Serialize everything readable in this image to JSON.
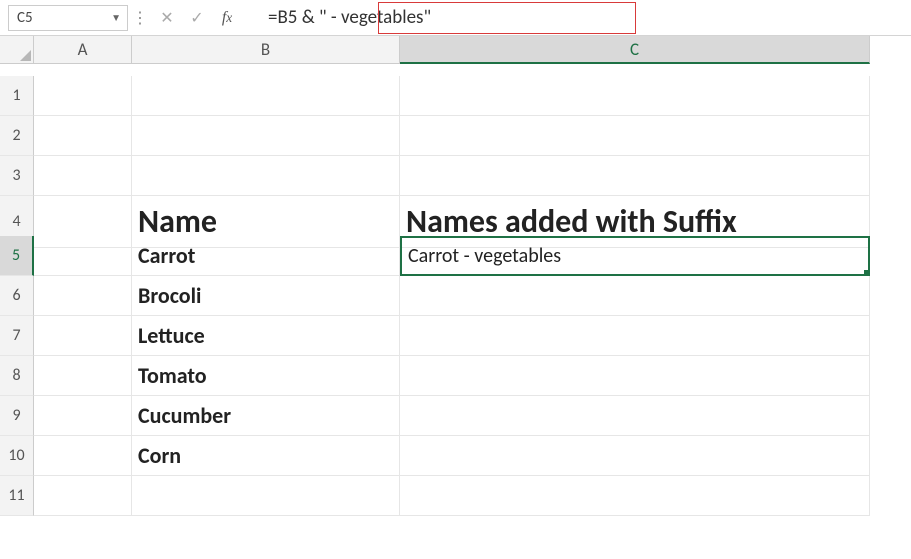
{
  "namebox": {
    "value": "C5"
  },
  "formula": {
    "text": "=B5 & \" - vegetables\""
  },
  "columns": {
    "A": "A",
    "B": "B",
    "C": "C"
  },
  "rows": [
    "1",
    "2",
    "3",
    "4",
    "5",
    "6",
    "7",
    "8",
    "9",
    "10",
    "11"
  ],
  "headers": {
    "B4": "Name",
    "C4": "Names added with Suffix"
  },
  "names": {
    "B5": "Carrot",
    "B6": "Brocoli",
    "B7": "Lettuce",
    "B8": "Tomato",
    "B9": "Cucumber",
    "B10": "Corn"
  },
  "results": {
    "C5": "Carrot - vegetables"
  },
  "chart_data": {
    "type": "table",
    "columns": [
      "Name",
      "Names added with Suffix"
    ],
    "rows": [
      [
        "Carrot",
        "Carrot - vegetables"
      ],
      [
        "Brocoli",
        ""
      ],
      [
        "Lettuce",
        ""
      ],
      [
        "Tomato",
        ""
      ],
      [
        "Cucumber",
        ""
      ],
      [
        "Corn",
        ""
      ]
    ],
    "formula_C5": "=B5 & \" - vegetables\"",
    "active_cell": "C5"
  }
}
